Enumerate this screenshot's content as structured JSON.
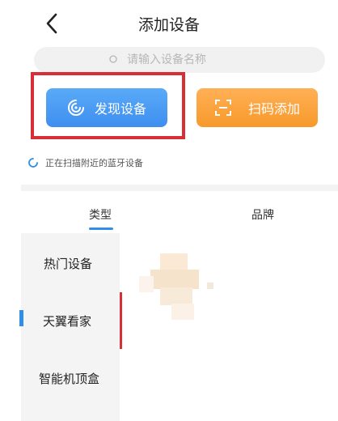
{
  "header": {
    "title": "添加设备",
    "back_icon": "chevron-left-icon"
  },
  "search": {
    "placeholder": "请输入设备名称",
    "icon": "search-icon"
  },
  "actions": {
    "discover": {
      "label": "发现设备",
      "icon": "radar-icon",
      "color": "#4a9cf6"
    },
    "scan": {
      "label": "扫码添加",
      "icon": "scan-icon",
      "color": "#f8a23c"
    }
  },
  "status": {
    "text": "正在扫描附近的蓝牙设备"
  },
  "tabs": [
    {
      "label": "类型",
      "active": true
    },
    {
      "label": "品牌",
      "active": false
    }
  ],
  "categories": [
    {
      "label": "热门设备",
      "active": false
    },
    {
      "label": "天翼看家",
      "active": true
    },
    {
      "label": "智能机顶盒",
      "active": false
    }
  ],
  "colors": {
    "accent": "#2f8fe8",
    "highlight": "#d82e35"
  }
}
